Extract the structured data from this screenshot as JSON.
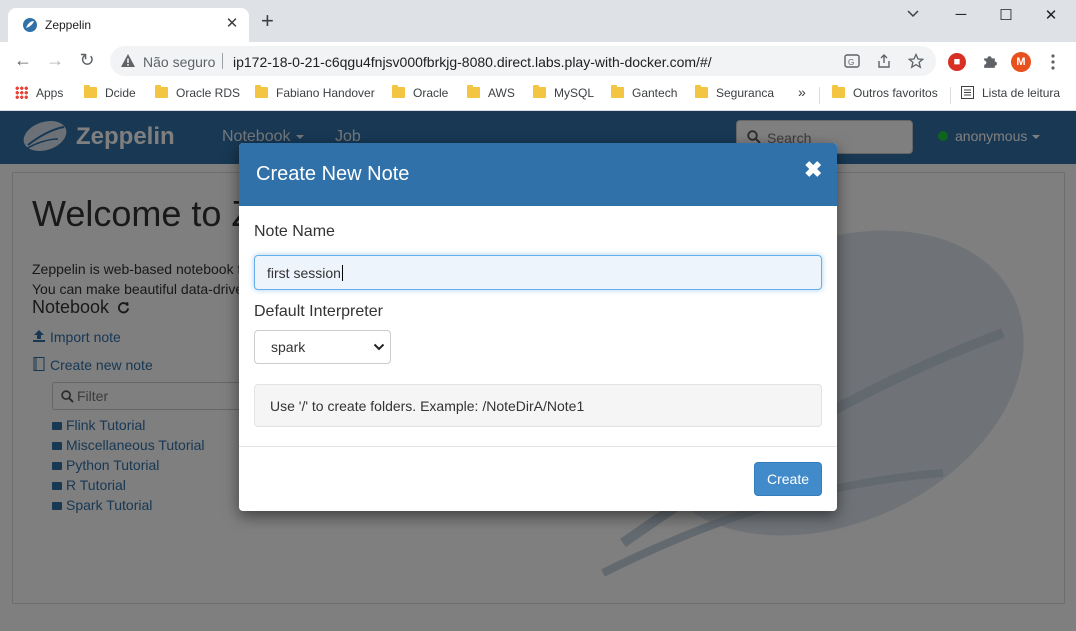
{
  "browser": {
    "tab_title": "Zeppelin",
    "tab_close": "✕",
    "new_tab": "+",
    "window_controls": {
      "minimize": "─",
      "maximize": "☐",
      "close": "✕"
    },
    "nav": {
      "back": "←",
      "forward": "→",
      "reload": "↻"
    },
    "security_label": "Não seguro",
    "url": "ip172-18-0-21-c6qgu4fnjsv000fbrkjg-8080.direct.labs.play-with-docker.com/#/",
    "extension_avatar_letter": "M",
    "bookmarks": [
      "Apps",
      "Dcide",
      "Oracle RDS",
      "Fabiano Handover",
      "Oracle",
      "AWS",
      "MySQL",
      "Gantech",
      "Seguranca"
    ],
    "bookmarks_overflow": "»",
    "other_favorites": "Outros favoritos",
    "reading_list": "Lista de leitura"
  },
  "navbar": {
    "brand": "Zeppelin",
    "notebook": "Notebook",
    "job": "Job",
    "search_placeholder": "Search",
    "user": "anonymous"
  },
  "home": {
    "welcome": "Welcome to Zeppelin!",
    "intro_line1": "Zeppelin is web-based notebook that enables interactive data analytics.",
    "intro_line2": "You can make beautiful data-driven, interactive and collaborative documents.",
    "notebook_heading": "Notebook",
    "import_note": "Import note",
    "create_new_note": "Create new note",
    "filter_placeholder": "Filter",
    "notes": [
      "Flink Tutorial",
      "Miscellaneous Tutorial",
      "Python Tutorial",
      "R Tutorial",
      "Spark Tutorial"
    ]
  },
  "modal": {
    "title": "Create New Note",
    "close": "✖",
    "note_name_label": "Note Name",
    "note_name_value": "first session",
    "interpreter_label": "Default Interpreter",
    "interpreter_selected": "spark",
    "hint": "Use '/' to create folders. Example: /NoteDirA/Note1",
    "create_button": "Create"
  },
  "colors": {
    "zeppelin_blue": "#3071a9",
    "button_primary": "#428bca",
    "status_online": "#1dc73a",
    "tabstrip": "#dee1e6"
  }
}
